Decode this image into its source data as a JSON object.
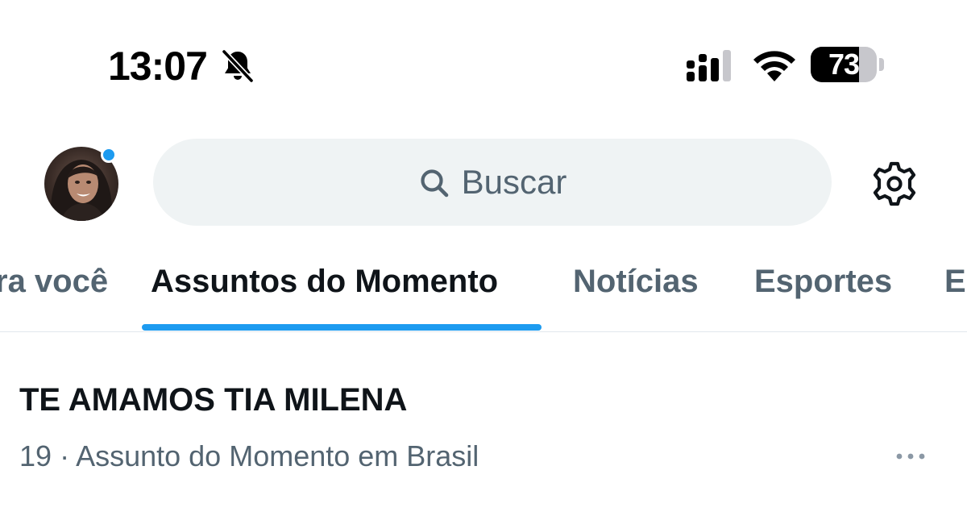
{
  "status_bar": {
    "time": "13:07",
    "battery_percent": "73",
    "battery_level": 0.73,
    "icons": {
      "notifications": "bell-muted-icon",
      "signal": "cellular-signal-icon",
      "wifi": "wifi-icon"
    }
  },
  "header": {
    "avatar_icon": "profile-avatar",
    "notification_dot_color": "#1d9bf0",
    "search": {
      "icon": "search-icon",
      "placeholder": "Buscar"
    },
    "settings_icon": "gear-icon"
  },
  "tabs": [
    {
      "label": "ra você",
      "active": false
    },
    {
      "label": "Assuntos do Momento",
      "active": true
    },
    {
      "label": "Notícias",
      "active": false
    },
    {
      "label": "Esportes",
      "active": false
    },
    {
      "label": "E",
      "active": false
    }
  ],
  "accent_color": "#1d9bf0",
  "trend": {
    "title": "TE AMAMOS TIA MILENA",
    "rank": "19",
    "separator": "·",
    "context": "Assunto do Momento em Brasil",
    "more_icon": "more-options-icon"
  }
}
